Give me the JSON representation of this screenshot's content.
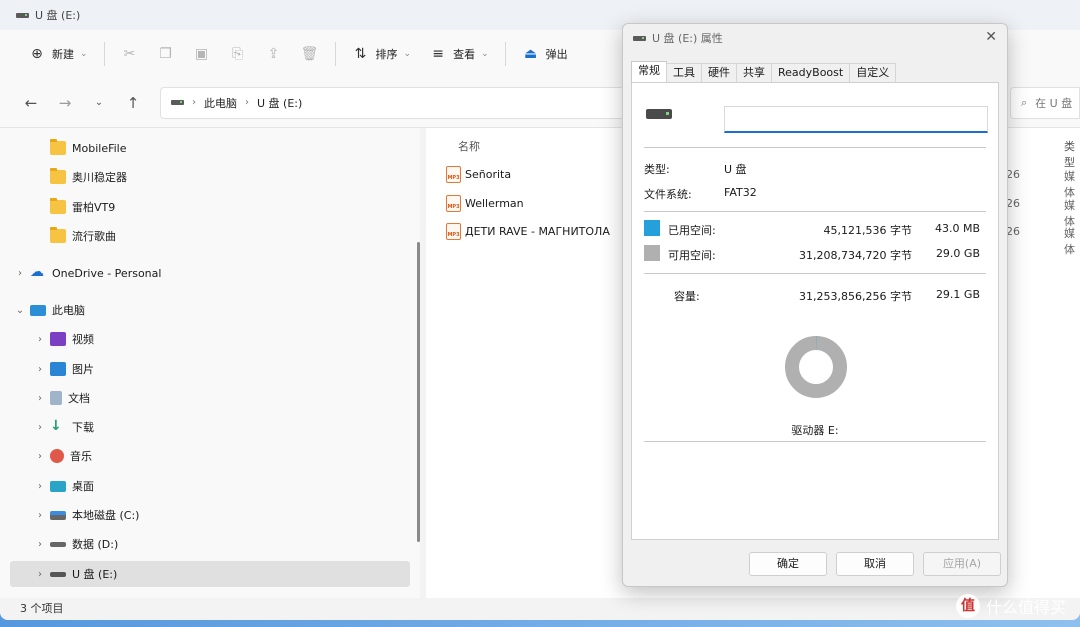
{
  "window": {
    "title": "U 盘 (E:)"
  },
  "toolbar": {
    "new_label": "新建",
    "sort_label": "排序",
    "view_label": "查看",
    "eject_label": "弹出"
  },
  "address": {
    "crumb_pc": "此电脑",
    "crumb_drive": "U 盘 (E:)",
    "search_placeholder": "在 U 盘"
  },
  "sidebar": {
    "items": [
      {
        "label": "MobileFile"
      },
      {
        "label": "奥川稳定器"
      },
      {
        "label": "雷柏VT9"
      },
      {
        "label": "流行歌曲"
      },
      {
        "label": "OneDrive - Personal"
      },
      {
        "label": "此电脑"
      },
      {
        "label": "视频"
      },
      {
        "label": "图片"
      },
      {
        "label": "文档"
      },
      {
        "label": "下载"
      },
      {
        "label": "音乐"
      },
      {
        "label": "桌面"
      },
      {
        "label": "本地磁盘 (C:)"
      },
      {
        "label": "数据 (D:)"
      },
      {
        "label": "U 盘 (E:)"
      }
    ]
  },
  "content": {
    "column_name": "名称",
    "column_type": "类型",
    "files": [
      {
        "name": "Señorita",
        "date_partial": "26",
        "type_partial": "媒体"
      },
      {
        "name": "Wellerman",
        "date_partial": "26",
        "type_partial": "媒体"
      },
      {
        "name": "ДЕТИ RAVE - МАГНИТОЛА",
        "date_partial": "26",
        "type_partial": "媒体"
      }
    ],
    "file_icon_text": "MP3"
  },
  "status": {
    "item_count": "3 个项目"
  },
  "dialog": {
    "title": "U 盘 (E:) 属性",
    "tabs": [
      "常规",
      "工具",
      "硬件",
      "共享",
      "ReadyBoost",
      "自定义"
    ],
    "name_value": "",
    "type_label": "类型:",
    "type_value": "U 盘",
    "fs_label": "文件系统:",
    "fs_value": "FAT32",
    "used_label": "已用空间:",
    "used_bytes": "45,121,536 字节",
    "used_size": "43.0 MB",
    "free_label": "可用空间:",
    "free_bytes": "31,208,734,720 字节",
    "free_size": "29.0 GB",
    "capacity_label": "容量:",
    "capacity_bytes": "31,253,856,256 字节",
    "capacity_size": "29.1 GB",
    "drive_caption": "驱动器 E:",
    "used_fraction": 0.00144,
    "used_color": "#26a0da",
    "free_color": "#b0b0b0",
    "ok_label": "确定",
    "cancel_label": "取消",
    "apply_label": "应用(A)"
  },
  "watermark": {
    "text": "什么值得买",
    "logo_text": "值"
  }
}
